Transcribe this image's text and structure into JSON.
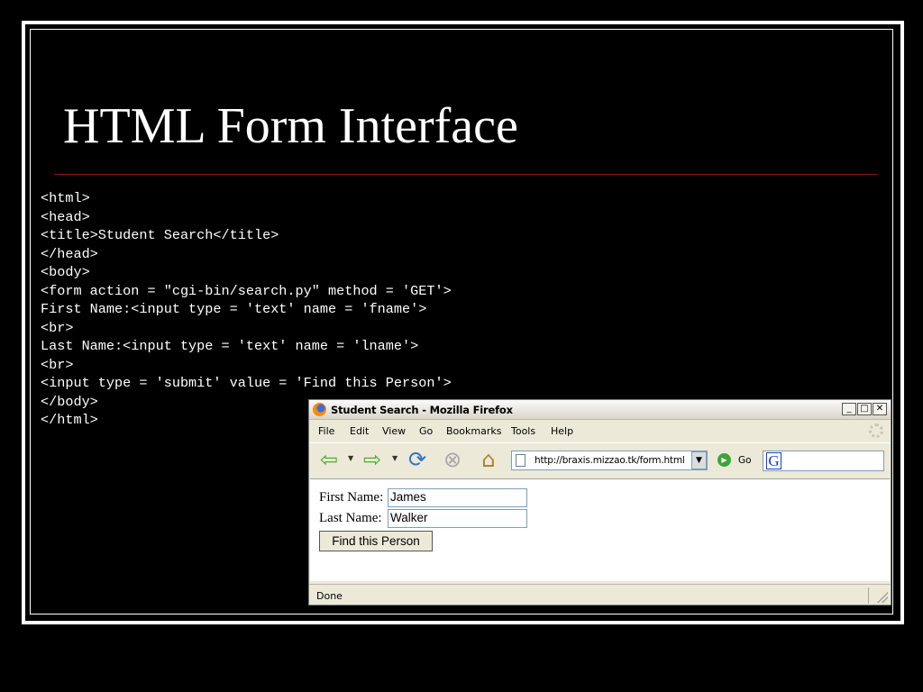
{
  "slide": {
    "title": "HTML Form Interface",
    "code_lines": [
      "<html>",
      "<head>",
      "<title>Student Search</title>",
      "</head>",
      "<body>",
      "<form action = \"cgi-bin/search.py\" method = 'GET'>",
      "First Name:<input type = 'text' name = 'fname'>",
      "<br>",
      "Last Name:<input type = 'text' name = 'lname'>",
      "<br>",
      "<input type = 'submit' value = 'Find this Person'>",
      "</body>",
      "</html>"
    ]
  },
  "browser": {
    "title": "Student Search - Mozilla Firefox",
    "window_buttons": {
      "minimize": "_",
      "maximize": "□",
      "close": "✕"
    },
    "menu": [
      "File",
      "Edit",
      "View",
      "Go",
      "Bookmarks",
      "Tools",
      "Help"
    ],
    "url": "http://braxis.mizzao.tk/form.html",
    "go_label": "Go",
    "search_engine_letter": "G",
    "form": {
      "first_name_label": "First Name:",
      "first_name_value": "James",
      "last_name_label": "Last Name:",
      "last_name_value": "Walker",
      "submit_label": "Find this Person"
    },
    "status": "Done"
  },
  "icons": [
    "back-arrow-icon",
    "forward-arrow-icon",
    "reload-icon",
    "stop-icon",
    "home-icon",
    "page-icon",
    "go-icon",
    "google-search-icon",
    "firefox-logo-icon",
    "throbber-icon",
    "resize-grip-icon"
  ]
}
